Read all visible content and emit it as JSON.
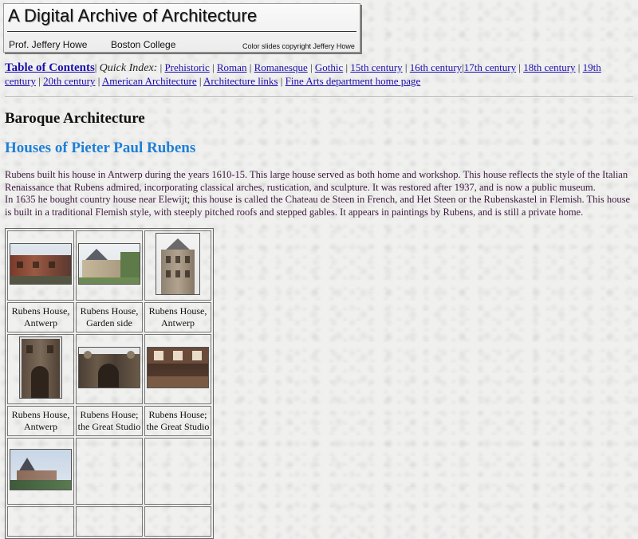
{
  "banner": {
    "title": "A Digital Archive of  Architecture",
    "author": "Prof. Jeffery Howe",
    "college": "Boston College",
    "copyright": "Color slides copyright Jeffery Howe"
  },
  "nav": {
    "toc": "Table of Contents",
    "quick_index": "Quick Index:",
    "links": [
      "Prehistoric",
      "Roman",
      "Romanesque",
      "Gothic",
      "15th century",
      "16th century",
      "17th century",
      "18th century",
      "19th century",
      "20th century",
      "American Architecture",
      "Architecture links",
      "Fine Arts department home page"
    ]
  },
  "section": "Baroque Architecture",
  "page_title": "Houses of Pieter Paul Rubens",
  "intro": {
    "p1": "Rubens built his house in Antwerp during the years 1610-15. This large house served as both home and workshop. This house reflects the style of the Italian Renaissance that Rubens admired, incorporating classical arches, rustication, and sculpture. It was restored after 1937, and is now a public museum.",
    "p2": "In 1635 he bought country house near Elewijt; this house is called the Chateau de Steen in French, and Het Steen or the Rubenskastel in Flemish. This house is built in a traditional Flemish style, with steeply pitched roofs and stepped gables. It appears in paintings by Rubens, and is still a private home."
  },
  "gallery": {
    "row1": [
      "Rubens House, Antwerp",
      "Rubens House, Garden side",
      "Rubens House, Antwerp"
    ],
    "row2": [
      "Rubens House, Antwerp",
      "Rubens House; the Great Studio",
      "Rubens House; the Great Studio"
    ]
  },
  "colors": {
    "link": "#1a0dab",
    "page_title": "#1e7fd6",
    "body_text": "#3a1a3a"
  }
}
